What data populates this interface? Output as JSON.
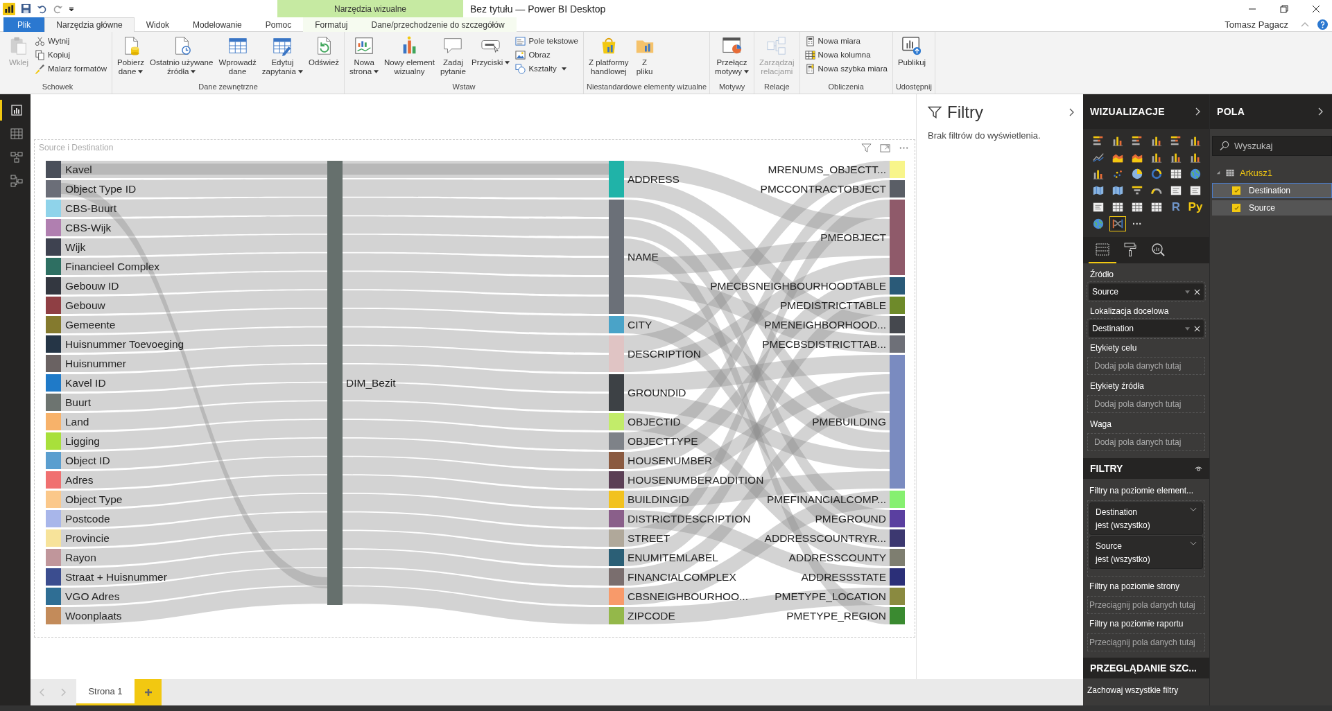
{
  "title_bar": {
    "title": "Bez tytułu — Power BI Desktop",
    "context_group": "Narzędzia wizualne"
  },
  "ribbon_tabs": [
    {
      "label": "Plik",
      "kind": "file",
      "selected": false
    },
    {
      "label": "Narzędzia główne",
      "kind": "main",
      "selected": true
    },
    {
      "label": "Widok",
      "kind": "main",
      "selected": false
    },
    {
      "label": "Modelowanie",
      "kind": "main",
      "selected": false
    },
    {
      "label": "Pomoc",
      "kind": "main",
      "selected": false
    },
    {
      "label": "Formatuj",
      "kind": "context",
      "selected": false
    },
    {
      "label": "Dane/przechodzenie do szczegółów",
      "kind": "context",
      "selected": false
    }
  ],
  "user_name": "Tomasz Pagacz",
  "ribbon_groups": [
    {
      "label": "Schowek",
      "buttons": [
        {
          "label": "Wklej",
          "disabled": true,
          "dropdown": false
        }
      ],
      "small_buttons": [
        {
          "label": "Wytnij",
          "dropdown": false
        },
        {
          "label": "Kopiuj",
          "dropdown": false
        },
        {
          "label": "Malarz formatów",
          "dropdown": false
        }
      ]
    },
    {
      "label": "Dane zewnętrzne",
      "buttons": [
        {
          "label": "Pobierz\ndane",
          "disabled": false,
          "dropdown": true
        },
        {
          "label": "Ostatnio używane\nźródła",
          "disabled": false,
          "dropdown": true
        },
        {
          "label": "Wprowadź\ndane",
          "disabled": false,
          "dropdown": false
        },
        {
          "label": "Edytuj\nzapytania",
          "disabled": false,
          "dropdown": true
        },
        {
          "label": "Odśwież",
          "disabled": false,
          "dropdown": false
        }
      ]
    },
    {
      "label": "Wstaw",
      "buttons": [
        {
          "label": "Nowa\nstrona",
          "disabled": false,
          "dropdown": true
        },
        {
          "label": "Nowy element\nwizualny",
          "disabled": false,
          "dropdown": false
        },
        {
          "label": "Zadaj\npytanie",
          "disabled": false,
          "dropdown": false
        },
        {
          "label": "Przyciski",
          "disabled": false,
          "dropdown": true
        }
      ],
      "small_buttons": [
        {
          "label": "Pole tekstowe",
          "dropdown": false
        },
        {
          "label": "Obraz",
          "dropdown": false
        },
        {
          "label": "Kształty",
          "dropdown": true
        }
      ]
    },
    {
      "label": "Niestandardowe elementy wizualne",
      "buttons": [
        {
          "label": "Z platformy\nhandlowej",
          "disabled": false,
          "dropdown": false
        },
        {
          "label": "Z\npliku",
          "disabled": false,
          "dropdown": false
        }
      ]
    },
    {
      "label": "Motywy",
      "buttons": [
        {
          "label": "Przełącz\nmotywy",
          "disabled": false,
          "dropdown": true
        }
      ]
    },
    {
      "label": "Relacje",
      "buttons": [
        {
          "label": "Zarządzaj\nrelacjami",
          "disabled": true,
          "dropdown": false
        }
      ]
    },
    {
      "label": "Obliczenia",
      "small_buttons": [
        {
          "label": "Nowa miara",
          "dropdown": false
        },
        {
          "label": "Nowa kolumna",
          "dropdown": false
        },
        {
          "label": "Nowa szybka miara",
          "dropdown": false
        }
      ]
    },
    {
      "label": "Udostępnij",
      "buttons": [
        {
          "label": "Publikuj",
          "disabled": false,
          "dropdown": false
        }
      ]
    }
  ],
  "left_nav": [
    {
      "selected": true
    },
    {
      "selected": false
    },
    {
      "selected": false
    },
    {
      "selected": false
    }
  ],
  "visual": {
    "title": "Source i Destination",
    "sankey": {
      "sources": [
        {
          "label": "Kavel",
          "color": "#4a4f5a"
        },
        {
          "label": "Object Type ID",
          "color": "#6b6e78"
        },
        {
          "label": "CBS-Buurt",
          "color": "#8fd3ea"
        },
        {
          "label": "CBS-Wijk",
          "color": "#b07fb0"
        },
        {
          "label": "Wijk",
          "color": "#3e4250"
        },
        {
          "label": "Financieel Complex",
          "color": "#2e6f62"
        },
        {
          "label": "Gebouw ID",
          "color": "#333740"
        },
        {
          "label": "Gebouw",
          "color": "#8f3f44"
        },
        {
          "label": "Gemeente",
          "color": "#847a2e"
        },
        {
          "label": "Huisnummer Toevoeging",
          "color": "#253546"
        },
        {
          "label": "Huisnummer",
          "color": "#6a6262"
        },
        {
          "label": "Kavel ID",
          "color": "#1f7ac8"
        },
        {
          "label": "Buurt",
          "color": "#6d7470"
        },
        {
          "label": "Land",
          "color": "#f7b26a"
        },
        {
          "label": "Ligging",
          "color": "#a8e03b"
        },
        {
          "label": "Object ID",
          "color": "#5a9ecf"
        },
        {
          "label": "Adres",
          "color": "#f07070"
        },
        {
          "label": "Object Type",
          "color": "#fbc88a"
        },
        {
          "label": "Postcode",
          "color": "#a8b6ea"
        },
        {
          "label": "Provincie",
          "color": "#f7e39a"
        },
        {
          "label": "Rayon",
          "color": "#c0969b"
        },
        {
          "label": "Straat + Huisnummer",
          "color": "#3b4d8f"
        },
        {
          "label": "VGO Adres",
          "color": "#2f6e94"
        },
        {
          "label": "Woonplaats",
          "color": "#c38b5a"
        }
      ],
      "hub": {
        "label": "DIM_Bezit",
        "color": "#66706d"
      },
      "targets": [
        {
          "label": "ADDRESS",
          "color": "#20b3a8"
        },
        {
          "label": "NAME",
          "color": "#6b7078"
        },
        {
          "label": "CITY",
          "color": "#4aa3c8"
        },
        {
          "label": "DESCRIPTION",
          "color": "#e0c4c4"
        },
        {
          "label": "GROUNDID",
          "color": "#3d4145"
        },
        {
          "label": "OBJECTID",
          "color": "#c2ec6a"
        },
        {
          "label": "OBJECTTYPE",
          "color": "#7e8288"
        },
        {
          "label": "HOUSENUMBER",
          "color": "#8a5a40"
        },
        {
          "label": "HOUSENUMBERADDITION",
          "color": "#5b3f55"
        },
        {
          "label": "BUILDINGID",
          "color": "#f2c21f"
        },
        {
          "label": "DISTRICTDESCRIPTION",
          "color": "#8a5f8a"
        },
        {
          "label": "STREET",
          "color": "#b0a89a"
        },
        {
          "label": "ENUMITEMLABEL",
          "color": "#2b5f76"
        },
        {
          "label": "FINANCIALCOMPLEX",
          "color": "#7a6e6e"
        },
        {
          "label": "CBSNEIGHBOURHOO...",
          "color": "#f89a6a"
        },
        {
          "label": "ZIPCODE",
          "color": "#94b84a"
        }
      ],
      "destinations": [
        {
          "label": "MRENUMS_OBJECTT...",
          "color": "#f8f58a"
        },
        {
          "label": "PMCCONTRACTOBJECT",
          "color": "#5a5e66"
        },
        {
          "label": "PMEOBJECT",
          "color": "#8f5a6a"
        },
        {
          "label": "PMECBSNEIGHBOURHOODTABLE",
          "color": "#2a5a78"
        },
        {
          "label": "PMEDISTRICTTABLE",
          "color": "#6e8a2a"
        },
        {
          "label": "PMENEIGHBORHOOD...",
          "color": "#45484e"
        },
        {
          "label": "PMECBSDISTRICTTAB...",
          "color": "#6e7078"
        },
        {
          "label": "PMEBUILDING",
          "color": "#7a8bc0"
        },
        {
          "label": "PMEFINANCIALCOMP...",
          "color": "#86f070"
        },
        {
          "label": "PMEGROUND",
          "color": "#5a3fa0"
        },
        {
          "label": "ADDRESSCOUNTRYR...",
          "color": "#3c3870"
        },
        {
          "label": "ADDRESSCOUNTY",
          "color": "#7e7e70"
        },
        {
          "label": "ADDRESSSTATE",
          "color": "#2b2f78"
        },
        {
          "label": "PMETYPE_LOCATION",
          "color": "#8a8a40"
        },
        {
          "label": "PMETYPE_REGION",
          "color": "#3a8a30"
        }
      ]
    }
  },
  "filters_pane": {
    "title": "Filtry",
    "empty_text": "Brak filtrów do wyświetlenia."
  },
  "visualizations": {
    "title": "WIZUALIZACJE",
    "gallery": [
      {
        "selected": false
      },
      {
        "selected": false
      },
      {
        "selected": false
      },
      {
        "selected": false
      },
      {
        "selected": false
      },
      {
        "selected": false
      },
      {
        "selected": false
      },
      {
        "selected": false
      },
      {
        "selected": false
      },
      {
        "selected": false
      },
      {
        "selected": false
      },
      {
        "selected": false
      },
      {
        "selected": false
      },
      {
        "selected": false
      },
      {
        "selected": false
      },
      {
        "selected": false
      },
      {
        "selected": false
      },
      {
        "selected": false
      },
      {
        "selected": false
      },
      {
        "selected": false
      },
      {
        "selected": false
      },
      {
        "selected": false
      },
      {
        "selected": false
      },
      {
        "selected": false
      },
      {
        "selected": false
      },
      {
        "selected": false
      },
      {
        "selected": false
      },
      {
        "selected": false
      },
      {
        "label": "R",
        "selected": false
      },
      {
        "label": "Py",
        "selected": false
      },
      {
        "selected": false
      },
      {
        "selected": true
      }
    ],
    "more_label": "···",
    "pane_tabs": [
      {
        "selected": true
      },
      {
        "selected": false
      },
      {
        "selected": false
      }
    ],
    "wells": [
      {
        "label": "Źródło",
        "field": "Source"
      },
      {
        "label": "Lokalizacja docelowa",
        "field": "Destination"
      },
      {
        "label": "Etykiety celu",
        "placeholder": "Dodaj pola danych tutaj"
      },
      {
        "label": "Etykiety źródła",
        "placeholder": "Dodaj pola danych tutaj"
      },
      {
        "label": "Waga",
        "placeholder": "Dodaj pola danych tutaj"
      }
    ],
    "filters": {
      "title": "FILTRY",
      "visual_level_label": "Filtry na poziomie element...",
      "cards": [
        {
          "field": "Destination",
          "condition": "jest (wszystko)"
        },
        {
          "field": "Source",
          "condition": "jest (wszystko)"
        }
      ],
      "page_level_label": "Filtry na poziomie strony",
      "page_level_placeholder": "Przeciągnij pola danych tutaj",
      "report_level_label": "Filtry na poziomie raportu",
      "report_level_placeholder": "Przeciągnij pola danych tutaj"
    },
    "drillthrough": {
      "title": "PRZEGLĄDANIE SZC...",
      "keep_filters_label": "Zachowaj wszystkie filtry"
    }
  },
  "fields_pane": {
    "title": "POLA",
    "search": {
      "placeholder": "Wyszukaj"
    },
    "tables": [
      {
        "name": "Arkusz1",
        "expanded": true,
        "fields": [
          {
            "name": "Destination",
            "checked": true,
            "selected": true
          },
          {
            "name": "Source",
            "checked": true,
            "selected": false
          }
        ]
      }
    ]
  },
  "page_tabs": [
    {
      "label": "Strona 1",
      "selected": true
    }
  ]
}
